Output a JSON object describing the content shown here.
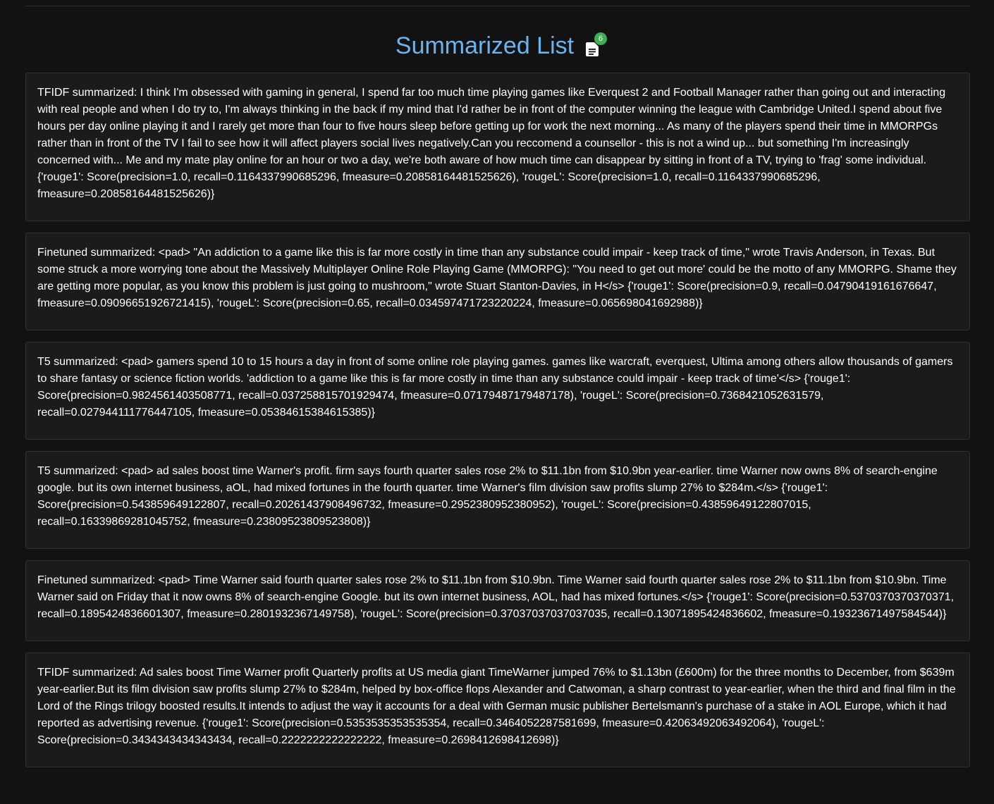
{
  "header": {
    "title": "Summarized List",
    "icon": "document-list-icon",
    "count": "6",
    "accent_color": "#6cb4ee",
    "badge_color": "#3fae54"
  },
  "summaries": [
    "TFIDF summarized: I think I'm obsessed with gaming in general, I spend far too much time playing games like Everquest 2 and Football Manager rather than going out and interacting with real people and when I do try to, I'm always thinking in the back if my mind that I'd rather be in front of the computer winning the league with Cambridge United.I spend about five hours per day online playing it and I rarely get more than four to five hours sleep before getting up for work the next morning... As many of the players spend their time in MMORPGs rather than in front of the TV I fail to see how it will affect players social lives negatively.Can you reccomend a counsellor - this is not a wind up... but something I'm increasingly concerned with... Me and my mate play online for an hour or two a day, we're both aware of how much time can disappear by sitting in front of a TV, trying to 'frag' some individual. {'rouge1': Score(precision=1.0, recall=0.1164337990685296, fmeasure=0.20858164481525626), 'rougeL': Score(precision=1.0, recall=0.1164337990685296, fmeasure=0.20858164481525626)}",
    "Finetuned summarized: <pad> \"An addiction to a game like this is far more costly in time than any substance could impair - keep track of time,\" wrote Travis Anderson, in Texas. But some struck a more worrying tone about the Massively Multiplayer Online Role Playing Game (MMORPG): \"You need to get out more' could be the motto of any MMORPG. Shame they are getting more popular, as you know this problem is just going to mushroom,\" wrote Stuart Stanton-Davies, in H</s> {'rouge1': Score(precision=0.9, recall=0.04790419161676647, fmeasure=0.09096651926721415), 'rougeL': Score(precision=0.65, recall=0.034597471723220224, fmeasure=0.065698041692988)}",
    "T5 summarized: <pad> gamers spend 10 to 15 hours a day in front of some online role playing games. games like warcraft, everquest, Ultima among others allow thousands of gamers to share fantasy or science fiction worlds. 'addiction to a game like this is far more costly in time than any substance could impair - keep track of time'</s> {'rouge1': Score(precision=0.9824561403508771, recall=0.037258815701929474, fmeasure=0.07179487179487178), 'rougeL': Score(precision=0.7368421052631579, recall=0.027944111776447105, fmeasure=0.05384615384615385)}",
    "T5 summarized: <pad> ad sales boost time Warner's profit. firm says fourth quarter sales rose 2% to $11.1bn from $10.9bn year-earlier. time Warner now owns 8% of search-engine google. but its own internet business, aOL, had mixed fortunes in the fourth quarter. time Warner's film division saw profits slump 27% to $284m.</s> {'rouge1': Score(precision=0.543859649122807, recall=0.20261437908496732, fmeasure=0.2952380952380952), 'rougeL': Score(precision=0.43859649122807015, recall=0.16339869281045752, fmeasure=0.23809523809523808)}",
    "Finetuned summarized: <pad> Time Warner said fourth quarter sales rose 2% to $11.1bn from $10.9bn. Time Warner said fourth quarter sales rose 2% to $11.1bn from $10.9bn. Time Warner said on Friday that it now owns 8% of search-engine Google. but its own internet business, AOL, had has mixed fortunes.</s> {'rouge1': Score(precision=0.5370370370370371, recall=0.1895424836601307, fmeasure=0.2801932367149758), 'rougeL': Score(precision=0.37037037037037035, recall=0.13071895424836602, fmeasure=0.19323671497584544)}",
    "TFIDF summarized: Ad sales boost Time Warner profit Quarterly profits at US media giant TimeWarner jumped 76% to $1.13bn (£600m) for the three months to December, from $639m year-earlier.But its film division saw profits slump 27% to $284m, helped by box-office flops Alexander and Catwoman, a sharp contrast to year-earlier, when the third and final film in the Lord of the Rings trilogy boosted results.It intends to adjust the way it accounts for a deal with German music publisher Bertelsmann's purchase of a stake in AOL Europe, which it had reported as advertising revenue. {'rouge1': Score(precision=0.5353535353535354, recall=0.3464052287581699, fmeasure=0.42063492063492064), 'rougeL': Score(precision=0.3434343434343434, recall=0.2222222222222222, fmeasure=0.2698412698412698)}"
  ]
}
